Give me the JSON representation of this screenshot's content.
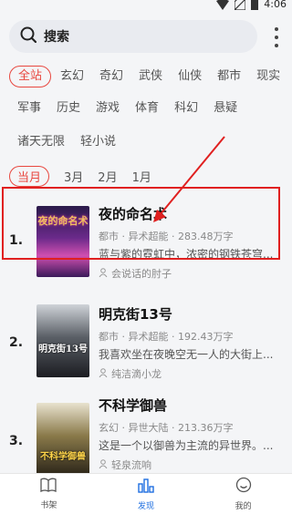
{
  "status": {
    "time": "4:06"
  },
  "search": {
    "placeholder": "搜索"
  },
  "categories": {
    "row1": [
      "全站",
      "玄幻",
      "奇幻",
      "武侠",
      "仙侠",
      "都市",
      "现实"
    ],
    "row2": [
      "军事",
      "历史",
      "游戏",
      "体育",
      "科幻",
      "悬疑"
    ],
    "row3": [
      "诸天无限",
      "轻小说"
    ],
    "selected": "全站"
  },
  "periods": {
    "items": [
      "当月",
      "3月",
      "2月",
      "1月"
    ],
    "selected": "当月"
  },
  "books": [
    {
      "rank": "1.",
      "title": "夜的命名术",
      "meta": "都市 · 异术超能 · 283.48万字",
      "desc": "蓝与紫的霓虹中，浓密的钢铁苍穹...",
      "author": "会说话的肘子",
      "cover_text": "夜的命名术"
    },
    {
      "rank": "2.",
      "title": "明克街13号",
      "meta": "都市 · 异术超能 · 192.43万字",
      "desc": "我喜欢坐在夜晚空无一人的大街上...",
      "author": "纯洁滴小龙",
      "cover_text": "明克街13号"
    },
    {
      "rank": "3.",
      "title": "不科学御兽",
      "meta": "玄幻 · 异世大陆 · 213.36万字",
      "desc": "这是一个以御兽为主流的异世界。...",
      "author": "轻泉流响",
      "cover_text": "不科学御兽"
    }
  ],
  "tabbar": {
    "items": [
      "书架",
      "发现",
      "我的"
    ],
    "selected": "发现"
  },
  "colors": {
    "accent": "#e8473f",
    "tab_active": "#1f6fe0",
    "highlight": "#e02020"
  }
}
